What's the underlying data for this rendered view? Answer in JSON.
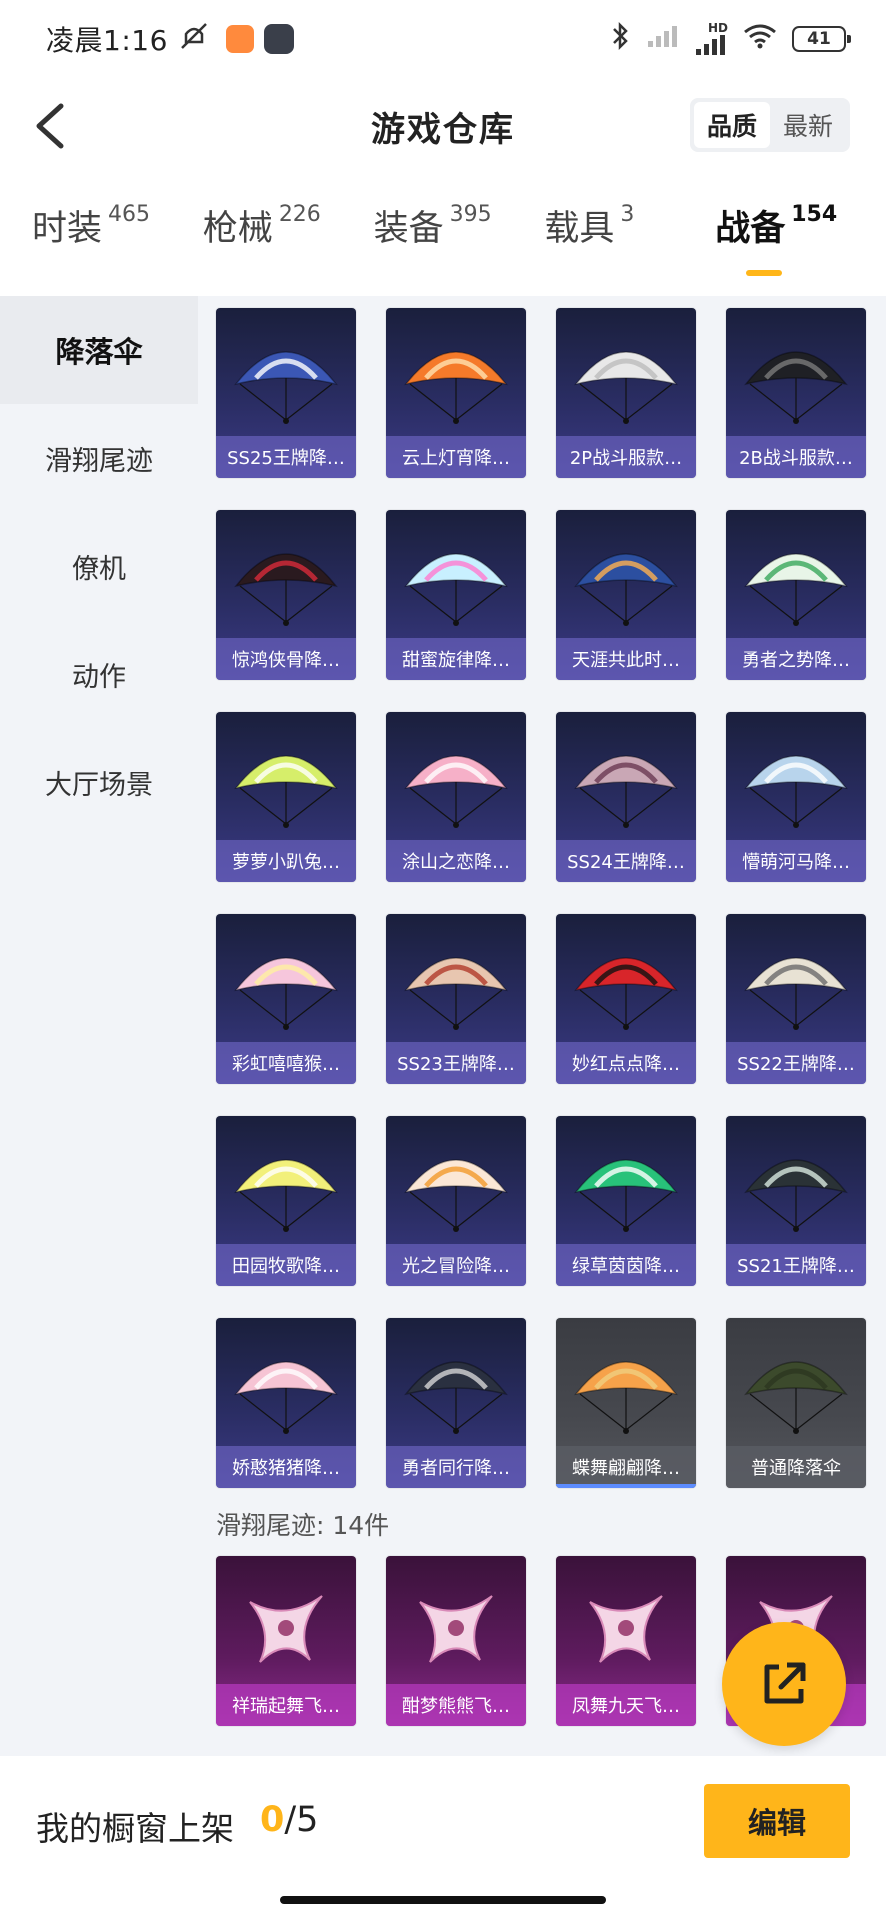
{
  "status_bar": {
    "time": "凌晨1:16",
    "battery": "41",
    "network": "HD"
  },
  "header": {
    "title": "游戏仓库",
    "sort_options": [
      "品质",
      "最新"
    ],
    "active_sort": "品质"
  },
  "tabs": [
    {
      "label": "时装",
      "count": "465"
    },
    {
      "label": "枪械",
      "count": "226"
    },
    {
      "label": "装备",
      "count": "395"
    },
    {
      "label": "载具",
      "count": "3"
    },
    {
      "label": "战备",
      "count": "154"
    }
  ],
  "active_tab": "战备",
  "sidebar": {
    "items": [
      {
        "label": "降落伞"
      },
      {
        "label": "滑翔尾迹"
      },
      {
        "label": "僚机"
      },
      {
        "label": "动作"
      },
      {
        "label": "大厅场景"
      }
    ],
    "active": "降落伞"
  },
  "parachutes": [
    {
      "name": "SS25王牌降…",
      "color": "#3b57b5",
      "accent": "#ffffff"
    },
    {
      "name": "云上灯宵降…",
      "color": "#f57a2a",
      "accent": "#ffe2b0"
    },
    {
      "name": "2P战斗服款…",
      "color": "#e8e8e8",
      "accent": "#bbbbbb"
    },
    {
      "name": "2B战斗服款…",
      "color": "#1f2025",
      "accent": "#7a7a7a"
    },
    {
      "name": "惊鸿侠骨降…",
      "color": "#2a1a1f",
      "accent": "#d82a3a"
    },
    {
      "name": "甜蜜旋律降…",
      "color": "#c8f0ff",
      "accent": "#ff7ad0"
    },
    {
      "name": "天涯共此时…",
      "color": "#2c4fa0",
      "accent": "#ffb050"
    },
    {
      "name": "勇者之势降…",
      "color": "#e8f5e8",
      "accent": "#37a85a"
    },
    {
      "name": "萝萝小趴兔…",
      "color": "#d6ee6a",
      "accent": "#ffffff"
    },
    {
      "name": "涂山之恋降…",
      "color": "#f6b0c8",
      "accent": "#ffffff"
    },
    {
      "name": "SS24王牌降…",
      "color": "#c9a7b5",
      "accent": "#6a3a52"
    },
    {
      "name": "懵萌河马降…",
      "color": "#b8d4ec",
      "accent": "#ffffff"
    },
    {
      "name": "彩虹嘻嘻猴…",
      "color": "#f6c6dc",
      "accent": "#fff0a0"
    },
    {
      "name": "SS23王牌降…",
      "color": "#e8c6b0",
      "accent": "#b03a2a"
    },
    {
      "name": "妙红点点降…",
      "color": "#d8252a",
      "accent": "#111111"
    },
    {
      "name": "SS22王牌降…",
      "color": "#e8e2d4",
      "accent": "#6a6a6a"
    },
    {
      "name": "田园牧歌降…",
      "color": "#f2f07a",
      "accent": "#ffffff"
    },
    {
      "name": "光之冒险降…",
      "color": "#fbe7d6",
      "accent": "#f29a2a"
    },
    {
      "name": "绿草茵茵降…",
      "color": "#28c27a",
      "accent": "#ffffff"
    },
    {
      "name": "SS21王牌降…",
      "color": "#2a3236",
      "accent": "#d8e8e0"
    },
    {
      "name": "娇憨猪猪降…",
      "color": "#f6c4d4",
      "accent": "#ffffff"
    },
    {
      "name": "勇者同行降…",
      "color": "#2a3040",
      "accent": "#d6d6d6"
    },
    {
      "name": "蝶舞翩翩降…",
      "color": "#f6a24a",
      "accent": "#f0d080"
    },
    {
      "name": "普通降落伞",
      "color": "#3c4a2c",
      "accent": "#2c3620"
    }
  ],
  "glide_section": {
    "title": "滑翔尾迹: 14件",
    "items": [
      {
        "name": "祥瑞起舞飞…"
      },
      {
        "name": "酣梦熊熊飞…"
      },
      {
        "name": "凤舞九天飞…"
      },
      {
        "name": "深…飞…"
      }
    ]
  },
  "bottom_bar": {
    "label": "我的橱窗上架",
    "current": "0",
    "separator_total": "/5",
    "edit_label": "编辑"
  }
}
